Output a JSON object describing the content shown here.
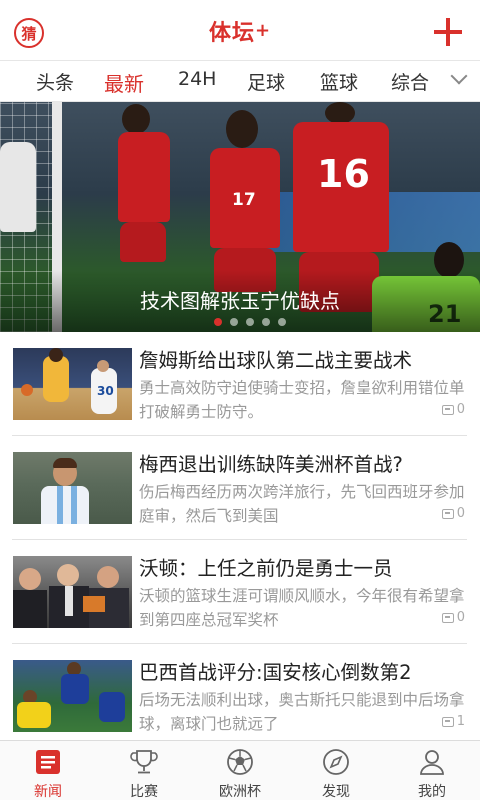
{
  "header": {
    "guess_label": "猜",
    "brand": "体坛",
    "brand_plus": "+"
  },
  "tabs": [
    {
      "label": "头条"
    },
    {
      "label": "最新",
      "active": true
    },
    {
      "label": "24H"
    },
    {
      "label": "足球"
    },
    {
      "label": "篮球"
    },
    {
      "label": "综合"
    }
  ],
  "hero": {
    "caption": "技术图解张玉宁优缺点",
    "jersey_numbers": [
      "17",
      "16",
      "21"
    ],
    "slide_count": 5,
    "active_slide": 1
  },
  "news": [
    {
      "title": "詹姆斯给出球队第二战主要战术",
      "desc": "勇士高效防守迫使骑士变招，詹皇欲利用错位单打破解勇士防守。",
      "comments": "0",
      "thumb_number": "30"
    },
    {
      "title": "梅西退出训练缺阵美洲杯首战?",
      "desc": "伤后梅西经历两次跨洋旅行，先飞回西班牙参加庭审，然后飞到美国",
      "comments": "0"
    },
    {
      "title": "沃顿：上任之前仍是勇士一员",
      "desc": "沃顿的篮球生涯可谓顺风顺水，今年很有希望拿到第四座总冠军奖杯",
      "comments": "0"
    },
    {
      "title": "巴西首战评分:国安核心倒数第2",
      "desc": "后场无法顺利出球，奥古斯托只能退到中后场拿球，离球门也就远了",
      "comments": "1"
    }
  ],
  "bottom_nav": [
    {
      "label": "新闻",
      "icon": "news-icon",
      "active": true
    },
    {
      "label": "比赛",
      "icon": "trophy-icon"
    },
    {
      "label": "欧洲杯",
      "icon": "football-icon"
    },
    {
      "label": "发现",
      "icon": "compass-icon"
    },
    {
      "label": "我的",
      "icon": "person-icon"
    }
  ],
  "colors": {
    "accent": "#d9312c",
    "text": "#222222",
    "muted": "#999999"
  }
}
